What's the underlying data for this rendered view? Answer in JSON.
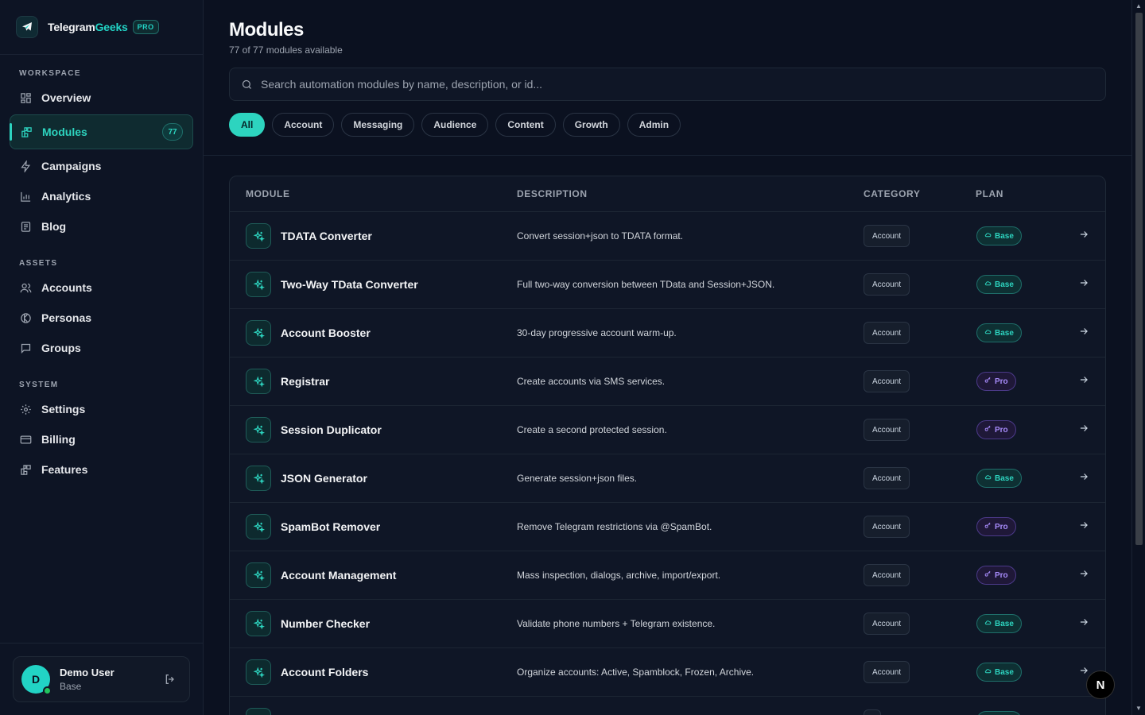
{
  "brand": {
    "name_main": "Telegram",
    "name_accent": "Geeks",
    "badge": "PRO"
  },
  "sidebar": {
    "workspace_label": "WORKSPACE",
    "assets_label": "ASSETS",
    "system_label": "SYSTEM",
    "workspace": [
      {
        "label": "Overview",
        "icon": "grid-icon"
      },
      {
        "label": "Modules",
        "icon": "modules-icon",
        "count": "77",
        "active": true
      },
      {
        "label": "Campaigns",
        "icon": "bolt-icon"
      },
      {
        "label": "Analytics",
        "icon": "bar-chart-icon"
      },
      {
        "label": "Blog",
        "icon": "book-icon"
      }
    ],
    "assets": [
      {
        "label": "Accounts",
        "icon": "users-icon"
      },
      {
        "label": "Personas",
        "icon": "persona-icon"
      },
      {
        "label": "Groups",
        "icon": "chat-icon"
      }
    ],
    "system": [
      {
        "label": "Settings",
        "icon": "gear-icon"
      },
      {
        "label": "Billing",
        "icon": "card-icon"
      },
      {
        "label": "Features",
        "icon": "features-icon"
      }
    ],
    "user": {
      "initial": "D",
      "name": "Demo User",
      "plan": "Base"
    }
  },
  "header": {
    "title": "Modules",
    "subtitle": "77 of 77 modules available",
    "search_placeholder": "Search automation modules by name, description, or id...",
    "filters": [
      "All",
      "Account",
      "Messaging",
      "Audience",
      "Content",
      "Growth",
      "Admin"
    ],
    "active_filter": "All"
  },
  "table": {
    "columns": {
      "module": "MODULE",
      "description": "DESCRIPTION",
      "category": "CATEGORY",
      "plan": "PLAN"
    },
    "rows": [
      {
        "name": "TDATA Converter",
        "description": "Convert session+json to TDATA format.",
        "category": "Account",
        "plan": "Base"
      },
      {
        "name": "Two-Way TData Converter",
        "description": "Full two-way conversion between TData and Session+JSON.",
        "category": "Account",
        "plan": "Base"
      },
      {
        "name": "Account Booster",
        "description": "30-day progressive account warm-up.",
        "category": "Account",
        "plan": "Base"
      },
      {
        "name": "Registrar",
        "description": "Create accounts via SMS services.",
        "category": "Account",
        "plan": "Pro"
      },
      {
        "name": "Session Duplicator",
        "description": "Create a second protected session.",
        "category": "Account",
        "plan": "Pro"
      },
      {
        "name": "JSON Generator",
        "description": "Generate session+json files.",
        "category": "Account",
        "plan": "Base"
      },
      {
        "name": "SpamBot Remover",
        "description": "Remove Telegram restrictions via @SpamBot.",
        "category": "Account",
        "plan": "Pro"
      },
      {
        "name": "Account Management",
        "description": "Mass inspection, dialogs, archive, import/export.",
        "category": "Account",
        "plan": "Pro"
      },
      {
        "name": "Number Checker",
        "description": "Validate phone numbers + Telegram existence.",
        "category": "Account",
        "plan": "Base"
      },
      {
        "name": "Account Folders",
        "description": "Organize accounts: Active, Spamblock, Frozen, Archive.",
        "category": "Account",
        "plan": "Base"
      },
      {
        "name": "",
        "description": "",
        "category": "",
        "plan": "Base"
      }
    ]
  },
  "colors": {
    "accent": "#2dd4bf",
    "pro": "#a78bfa",
    "background": "#0b1120"
  },
  "fab": {
    "label": "N"
  }
}
